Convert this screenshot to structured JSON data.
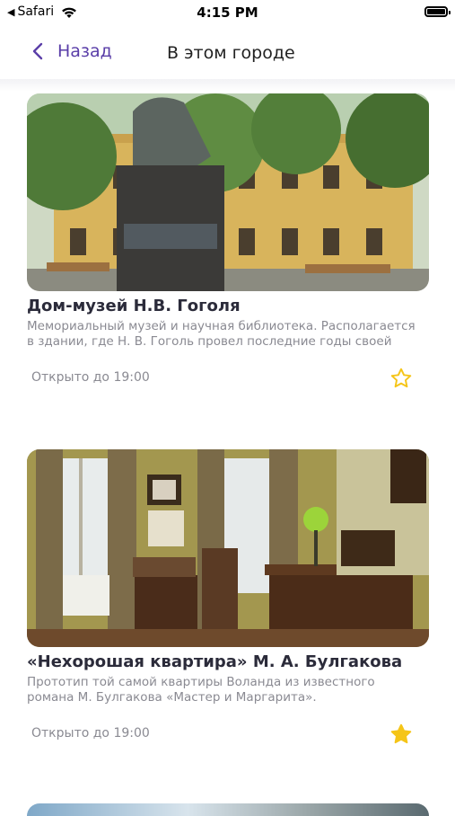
{
  "status": {
    "back_app": "Safari",
    "time": "4:15 PM"
  },
  "nav": {
    "back_label": "Назад",
    "title": "В этом городе"
  },
  "places": [
    {
      "title": "Дом-музей Н.В. Гоголя",
      "description": "Мемориальный музей и научная библиотека. Располагается в здании, где Н. В. Гоголь провел последние годы своей",
      "hours": "Открыто до 19:00",
      "favorite": false
    },
    {
      "title": "«Нехорошая квартира» М. А. Булгакова",
      "description": "Прототип той самой квартиры Воланда из известного романа М. Булгакова «Мастер и Маргарита».",
      "hours": "Открыто до 19:00",
      "favorite": true
    }
  ],
  "colors": {
    "accent": "#5a3ea8",
    "star": "#f5c518"
  }
}
